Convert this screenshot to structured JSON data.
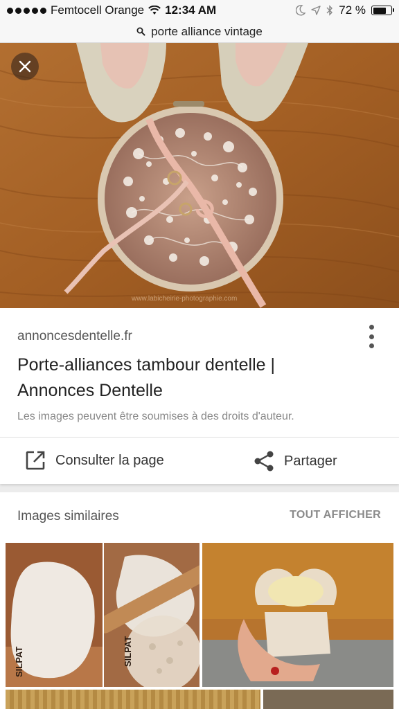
{
  "status_bar": {
    "carrier": "Femtocell Orange",
    "time": "12:34 AM",
    "battery": "72 %",
    "battery_level": 0.72
  },
  "search": {
    "query": "porte alliance vintage"
  },
  "hero": {
    "watermark": "www.labicheirie-photographie.com",
    "close_icon": "close-icon"
  },
  "result": {
    "domain": "annoncesdentelle.fr",
    "title": "Porte-alliances tambour dentelle | Annonces Dentelle",
    "copyright": "Les images peuvent être soumises à des droits d'auteur."
  },
  "actions": {
    "open_label": "Consulter la page",
    "share_label": "Partager"
  },
  "similar": {
    "header": "Images similaires",
    "show_all": "TOUT AFFICHER",
    "thumb_text_1": "SILPAT",
    "thumb_text_2": "SILPAT"
  }
}
